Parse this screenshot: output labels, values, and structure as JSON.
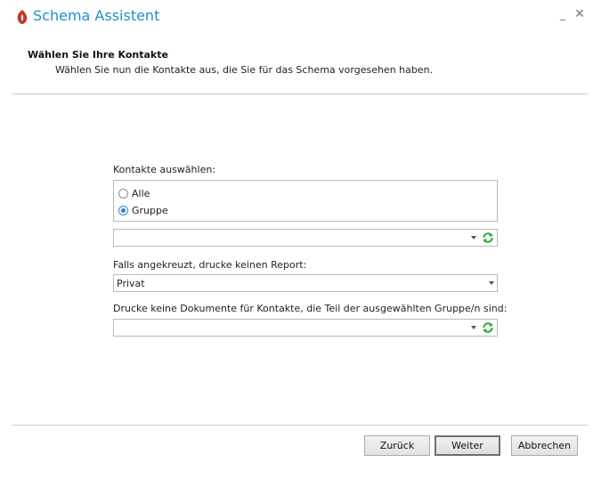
{
  "window": {
    "title": "Schema Assistent",
    "minimize": "_",
    "close": "✕"
  },
  "header": {
    "title": "Wählen Sie Ihre Kontakte",
    "subtitle": "Wählen Sie nun die Kontakte aus, die Sie für das Schema vorgesehen haben."
  },
  "contacts": {
    "label": "Kontakte auswählen:",
    "options": [
      {
        "label": "Alle",
        "checked": false
      },
      {
        "label": "Gruppe",
        "checked": true
      }
    ],
    "group_value": ""
  },
  "report": {
    "label": "Falls angekreuzt, drucke keinen Report:",
    "value": "Privat"
  },
  "exclude": {
    "label": "Drucke keine Dokumente für Kontakte, die Teil der ausgewählten Gruppe/n sind:",
    "value": ""
  },
  "buttons": {
    "back": "Zurück",
    "next": "Weiter",
    "cancel": "Abbrechen"
  },
  "colors": {
    "title": "#1f8fd0",
    "logo": "#c0392b",
    "refresh": "#2eaa3c",
    "radio_selected": "#2b7fd6"
  },
  "icons": {
    "logo": "flame-logo-icon",
    "refresh": "refresh-icon",
    "dropdown": "chevron-down-icon"
  }
}
